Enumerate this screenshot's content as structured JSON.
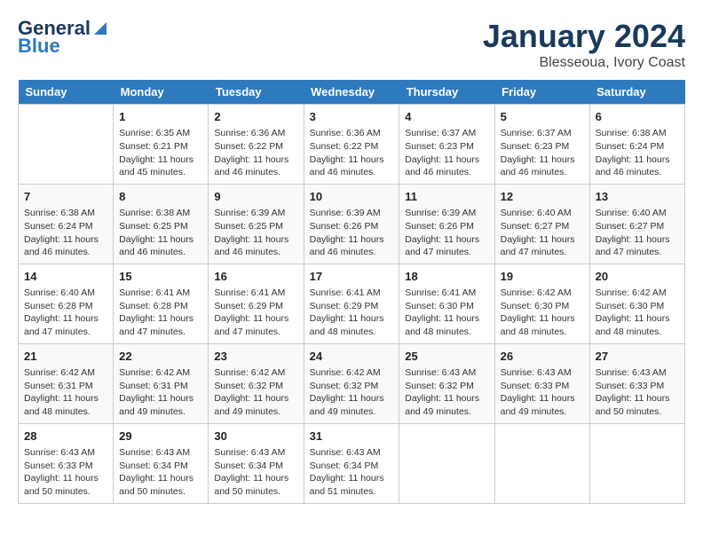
{
  "header": {
    "logo_line1": "General",
    "logo_line2": "Blue",
    "month": "January 2024",
    "location": "Blesseoua, Ivory Coast"
  },
  "days_of_week": [
    "Sunday",
    "Monday",
    "Tuesday",
    "Wednesday",
    "Thursday",
    "Friday",
    "Saturday"
  ],
  "weeks": [
    [
      {
        "day": "",
        "info": ""
      },
      {
        "day": "1",
        "info": "Sunrise: 6:35 AM\nSunset: 6:21 PM\nDaylight: 11 hours\nand 45 minutes."
      },
      {
        "day": "2",
        "info": "Sunrise: 6:36 AM\nSunset: 6:22 PM\nDaylight: 11 hours\nand 46 minutes."
      },
      {
        "day": "3",
        "info": "Sunrise: 6:36 AM\nSunset: 6:22 PM\nDaylight: 11 hours\nand 46 minutes."
      },
      {
        "day": "4",
        "info": "Sunrise: 6:37 AM\nSunset: 6:23 PM\nDaylight: 11 hours\nand 46 minutes."
      },
      {
        "day": "5",
        "info": "Sunrise: 6:37 AM\nSunset: 6:23 PM\nDaylight: 11 hours\nand 46 minutes."
      },
      {
        "day": "6",
        "info": "Sunrise: 6:38 AM\nSunset: 6:24 PM\nDaylight: 11 hours\nand 46 minutes."
      }
    ],
    [
      {
        "day": "7",
        "info": "Sunrise: 6:38 AM\nSunset: 6:24 PM\nDaylight: 11 hours\nand 46 minutes."
      },
      {
        "day": "8",
        "info": "Sunrise: 6:38 AM\nSunset: 6:25 PM\nDaylight: 11 hours\nand 46 minutes."
      },
      {
        "day": "9",
        "info": "Sunrise: 6:39 AM\nSunset: 6:25 PM\nDaylight: 11 hours\nand 46 minutes."
      },
      {
        "day": "10",
        "info": "Sunrise: 6:39 AM\nSunset: 6:26 PM\nDaylight: 11 hours\nand 46 minutes."
      },
      {
        "day": "11",
        "info": "Sunrise: 6:39 AM\nSunset: 6:26 PM\nDaylight: 11 hours\nand 47 minutes."
      },
      {
        "day": "12",
        "info": "Sunrise: 6:40 AM\nSunset: 6:27 PM\nDaylight: 11 hours\nand 47 minutes."
      },
      {
        "day": "13",
        "info": "Sunrise: 6:40 AM\nSunset: 6:27 PM\nDaylight: 11 hours\nand 47 minutes."
      }
    ],
    [
      {
        "day": "14",
        "info": "Sunrise: 6:40 AM\nSunset: 6:28 PM\nDaylight: 11 hours\nand 47 minutes."
      },
      {
        "day": "15",
        "info": "Sunrise: 6:41 AM\nSunset: 6:28 PM\nDaylight: 11 hours\nand 47 minutes."
      },
      {
        "day": "16",
        "info": "Sunrise: 6:41 AM\nSunset: 6:29 PM\nDaylight: 11 hours\nand 47 minutes."
      },
      {
        "day": "17",
        "info": "Sunrise: 6:41 AM\nSunset: 6:29 PM\nDaylight: 11 hours\nand 48 minutes."
      },
      {
        "day": "18",
        "info": "Sunrise: 6:41 AM\nSunset: 6:30 PM\nDaylight: 11 hours\nand 48 minutes."
      },
      {
        "day": "19",
        "info": "Sunrise: 6:42 AM\nSunset: 6:30 PM\nDaylight: 11 hours\nand 48 minutes."
      },
      {
        "day": "20",
        "info": "Sunrise: 6:42 AM\nSunset: 6:30 PM\nDaylight: 11 hours\nand 48 minutes."
      }
    ],
    [
      {
        "day": "21",
        "info": "Sunrise: 6:42 AM\nSunset: 6:31 PM\nDaylight: 11 hours\nand 48 minutes."
      },
      {
        "day": "22",
        "info": "Sunrise: 6:42 AM\nSunset: 6:31 PM\nDaylight: 11 hours\nand 49 minutes."
      },
      {
        "day": "23",
        "info": "Sunrise: 6:42 AM\nSunset: 6:32 PM\nDaylight: 11 hours\nand 49 minutes."
      },
      {
        "day": "24",
        "info": "Sunrise: 6:42 AM\nSunset: 6:32 PM\nDaylight: 11 hours\nand 49 minutes."
      },
      {
        "day": "25",
        "info": "Sunrise: 6:43 AM\nSunset: 6:32 PM\nDaylight: 11 hours\nand 49 minutes."
      },
      {
        "day": "26",
        "info": "Sunrise: 6:43 AM\nSunset: 6:33 PM\nDaylight: 11 hours\nand 49 minutes."
      },
      {
        "day": "27",
        "info": "Sunrise: 6:43 AM\nSunset: 6:33 PM\nDaylight: 11 hours\nand 50 minutes."
      }
    ],
    [
      {
        "day": "28",
        "info": "Sunrise: 6:43 AM\nSunset: 6:33 PM\nDaylight: 11 hours\nand 50 minutes."
      },
      {
        "day": "29",
        "info": "Sunrise: 6:43 AM\nSunset: 6:34 PM\nDaylight: 11 hours\nand 50 minutes."
      },
      {
        "day": "30",
        "info": "Sunrise: 6:43 AM\nSunset: 6:34 PM\nDaylight: 11 hours\nand 50 minutes."
      },
      {
        "day": "31",
        "info": "Sunrise: 6:43 AM\nSunset: 6:34 PM\nDaylight: 11 hours\nand 51 minutes."
      },
      {
        "day": "",
        "info": ""
      },
      {
        "day": "",
        "info": ""
      },
      {
        "day": "",
        "info": ""
      }
    ]
  ]
}
